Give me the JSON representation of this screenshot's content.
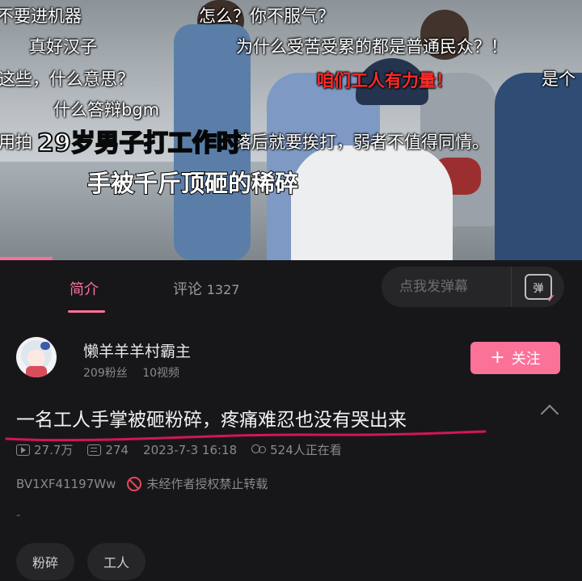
{
  "video": {
    "danmaku": [
      {
        "text": "不要进机器",
        "color": "#ffffff"
      },
      {
        "text": "怎么？你不服气？",
        "color": "#ffffff"
      },
      {
        "text": "真好汉子",
        "color": "#ffffff"
      },
      {
        "text": "为什么受苦受累的都是普通民众？！",
        "color": "#ffffff"
      },
      {
        "text": "这些，什么意思？",
        "color": "#ffffff"
      },
      {
        "text": "咱们工人有力量！",
        "color": "#ff2a2a"
      },
      {
        "text": "是个",
        "color": "#ffffff"
      },
      {
        "text": "什么答辩bgm",
        "color": "#ffffff"
      },
      {
        "text": "用拍",
        "color": "#ffffff"
      },
      {
        "text": "落后就要挨打，弱者不值得同情。",
        "color": "#ffffff"
      }
    ],
    "caption_line1": "29岁男子打工作时",
    "caption_line2": "手被千斤顶砸的稀碎",
    "progress_fraction": 0.09
  },
  "tabs": {
    "intro": "简介",
    "comments_label": "评论",
    "comments_count": "1327"
  },
  "danmaku_input": {
    "placeholder": "点我发弹幕",
    "button_glyph": "弹"
  },
  "uploader": {
    "name": "懒羊羊羊村霸主",
    "fans": "209粉丝",
    "videos": "10视频",
    "follow_label": "关注"
  },
  "video_info": {
    "title": "一名工人手掌被砸粉碎，疼痛难忍也没有哭出来",
    "views": "27.7万",
    "danmaku_count": "274",
    "date": "2023-7-3 16:18",
    "watching": "524人正在看",
    "bvid": "BV1XF41197Ww",
    "copyright_notice": "未经作者授权禁止转载",
    "description": "-"
  },
  "tags": [
    "粉碎",
    "工人"
  ],
  "colors": {
    "accent": "#fb7299",
    "background": "#17171a",
    "underline_mark": "#d4145a"
  }
}
